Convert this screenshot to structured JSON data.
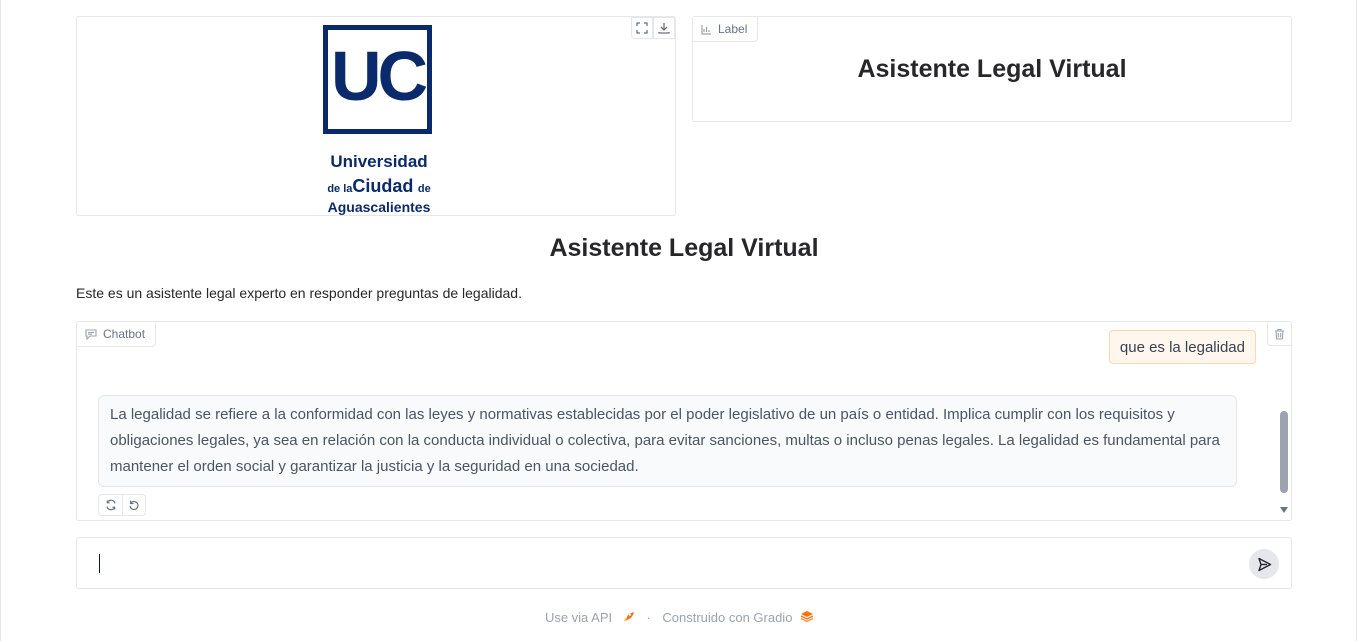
{
  "image_panel": {
    "logo": {
      "monogram": "UC",
      "line1": "Universidad",
      "line2_small_a": "de la",
      "line2_big": "Ciudad",
      "line2_small_b": "de",
      "line3": "Aguascalientes"
    },
    "fullscreen_icon": "fullscreen-icon",
    "download_icon": "download-icon"
  },
  "label_panel": {
    "label": "Label",
    "value": "Asistente Legal Virtual"
  },
  "page": {
    "title": "Asistente Legal Virtual",
    "description": "Este es un asistente legal experto en responder preguntas de legalidad."
  },
  "chatbot": {
    "label": "Chatbot",
    "messages": [
      {
        "role": "user",
        "text": "que es la legalidad"
      },
      {
        "role": "bot",
        "text": "La legalidad se refiere a la conformidad con las leyes y normativas establecidas por el poder legislativo de un país o entidad. Implica cumplir con los requisitos y obligaciones legales, ya sea en relación con la conducta individual o colectiva, para evitar sanciones, multas o incluso penas legales. La legalidad es fundamental para mantener el orden social y garantizar la justicia y la seguridad en una sociedad."
      }
    ]
  },
  "input": {
    "value": "",
    "placeholder": ""
  },
  "footer": {
    "api_link": "Use via API",
    "built_with": "Construido con Gradio",
    "separator": "·"
  },
  "colors": {
    "brand": "#0a2a6b",
    "user_bubble_bg": "#fff7ed",
    "user_bubble_border": "#fed7aa",
    "bot_bubble_bg": "#f9fafb"
  }
}
